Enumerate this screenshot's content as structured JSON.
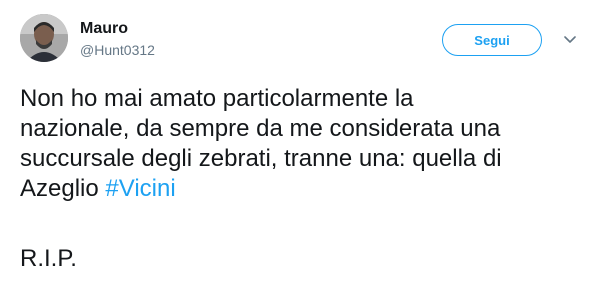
{
  "author": {
    "name": "Mauro",
    "handle": "@Hunt0312"
  },
  "actions": {
    "follow_label": "Segui",
    "caret_icon": "chevron-down-icon"
  },
  "tweet": {
    "text_line1": "Non ho mai amato particolarmente la",
    "text_line2": "nazionale, da sempre da me considerata una",
    "text_line3": "succursale degli zebrati, tranne una: quella di",
    "text_line4_prefix": "Azeglio ",
    "hashtag": "#Vicini",
    "signoff": "R.I.P."
  },
  "colors": {
    "accent": "#1da1f2",
    "text": "#14171a",
    "muted": "#657786"
  }
}
